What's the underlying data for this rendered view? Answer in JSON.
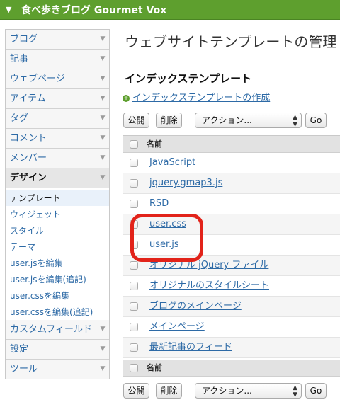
{
  "header": {
    "site_name": "食べ歩きブログ Gourmet Vox"
  },
  "sidebar": {
    "top_items": [
      {
        "label": "ブログ"
      },
      {
        "label": "記事"
      },
      {
        "label": "ウェブページ"
      },
      {
        "label": "アイテム"
      },
      {
        "label": "タグ"
      },
      {
        "label": "コメント"
      },
      {
        "label": "メンバー"
      }
    ],
    "active_item": {
      "label": "デザイン"
    },
    "sub_items": [
      {
        "label": "テンプレート",
        "current": true
      },
      {
        "label": "ウィジェット"
      },
      {
        "label": "スタイル"
      },
      {
        "label": "テーマ"
      },
      {
        "label": "user.jsを編集"
      },
      {
        "label": "user.jsを編集(追記)"
      },
      {
        "label": "user.cssを編集"
      },
      {
        "label": "user.cssを編集(追記)"
      }
    ],
    "bottom_items": [
      {
        "label": "カスタムフィールド"
      },
      {
        "label": "設定"
      },
      {
        "label": "ツール"
      }
    ]
  },
  "main": {
    "title": "ウェブサイトテンプレートの管理",
    "section_title": "インデックステンプレート",
    "create_link": "インデックステンプレートの作成",
    "actions": {
      "publish": "公開",
      "delete": "削除",
      "select_value": "アクション...",
      "go": "Go"
    },
    "table": {
      "column_name": "名前",
      "rows": [
        {
          "name": "JavaScript"
        },
        {
          "name": "jquery.gmap3.js"
        },
        {
          "name": "RSD"
        },
        {
          "name": "user.css"
        },
        {
          "name": "user.js"
        },
        {
          "name": "オリジナル jQuery ファイル"
        },
        {
          "name": "オリジナルのスタイルシート"
        },
        {
          "name": "ブログのメインページ"
        },
        {
          "name": "メインページ"
        },
        {
          "name": "最新記事のフィード"
        }
      ]
    }
  },
  "colors": {
    "header_bg": "#5e9f2e",
    "link": "#2d6aa6",
    "highlight": "#e2231a"
  }
}
